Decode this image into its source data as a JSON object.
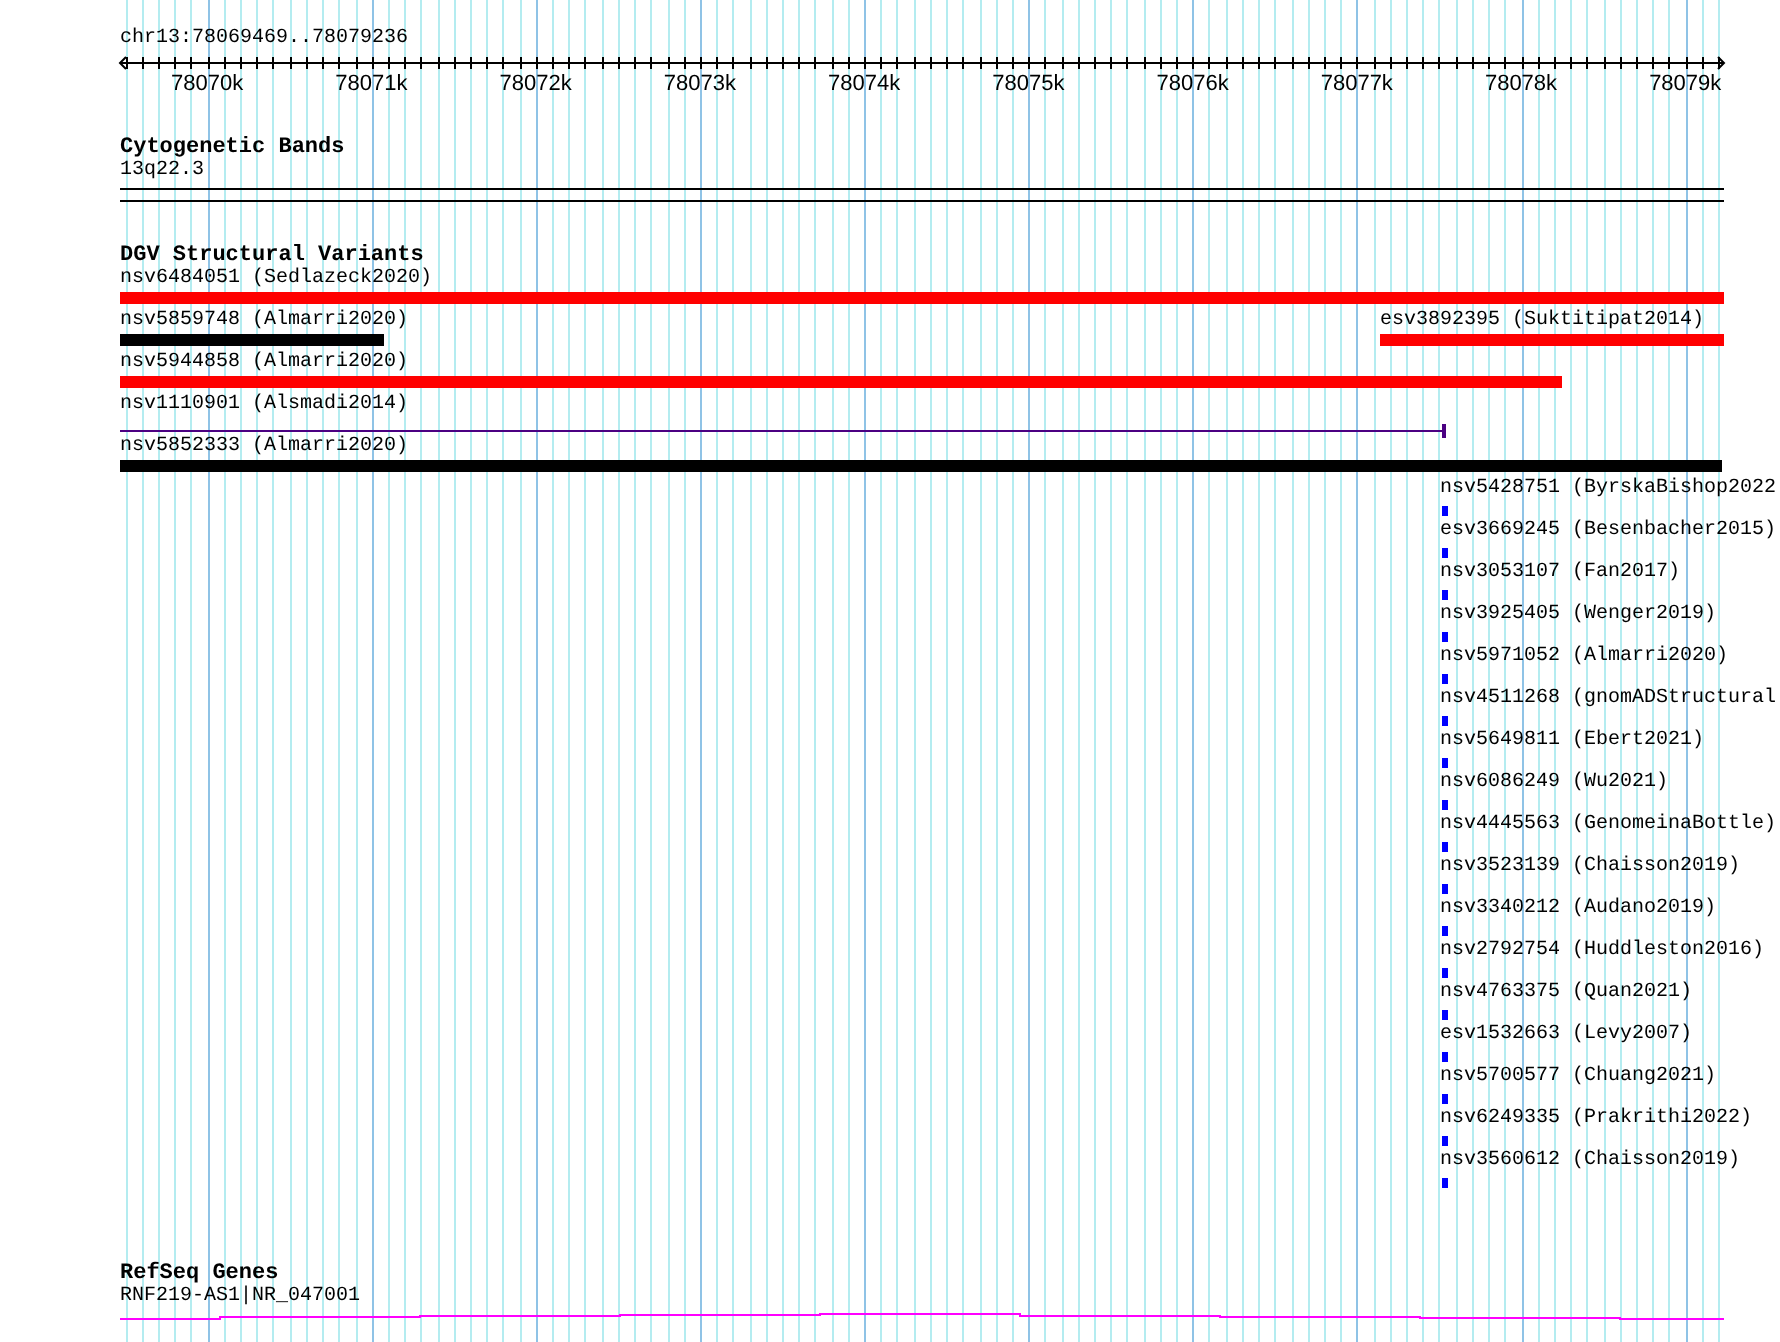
{
  "location": "chr13:78069469..78079236",
  "ruler": {
    "labels": [
      "78070k",
      "78071k",
      "78072k",
      "78073k",
      "78074k",
      "78075k",
      "78076k",
      "78077k",
      "78078k",
      "78079k"
    ]
  },
  "cytogenetic_bands": {
    "title": "Cytogenetic Bands",
    "band": {
      "label": "13q22.3"
    }
  },
  "dgv_structural_variants": {
    "title": "DGV Structural Variants",
    "features": [
      {
        "label": "nsv6484051 (Sedlazeck2020)",
        "kind": "bar",
        "color": "#ff0000"
      },
      {
        "label": "nsv5859748 (Almarri2020)",
        "kind": "bar",
        "color": "#000000"
      },
      {
        "label": "esv3892395 (Suktitipat2014)",
        "kind": "bar",
        "color": "#ff0000"
      },
      {
        "label": "nsv5944858 (Almarri2020)",
        "kind": "bar",
        "color": "#ff0000"
      },
      {
        "label": "nsv1110901 (Alsmadi2014)",
        "kind": "line",
        "color": "#4b0082"
      },
      {
        "label": "nsv5852333 (Almarri2020)",
        "kind": "bar",
        "color": "#000000"
      },
      {
        "label": "nsv5428751 (ByrskaBishop2022",
        "kind": "point",
        "color": "#0000ff"
      },
      {
        "label": "esv3669245 (Besenbacher2015)",
        "kind": "point",
        "color": "#0000ff"
      },
      {
        "label": "nsv3053107 (Fan2017)",
        "kind": "point",
        "color": "#0000ff"
      },
      {
        "label": "nsv3925405 (Wenger2019)",
        "kind": "point",
        "color": "#0000ff"
      },
      {
        "label": "nsv5971052 (Almarri2020)",
        "kind": "point",
        "color": "#0000ff"
      },
      {
        "label": "nsv4511268 (gnomADStructural",
        "kind": "point",
        "color": "#0000ff"
      },
      {
        "label": "nsv5649811 (Ebert2021)",
        "kind": "point",
        "color": "#0000ff"
      },
      {
        "label": "nsv6086249 (Wu2021)",
        "kind": "point",
        "color": "#0000ff"
      },
      {
        "label": "nsv4445563 (GenomeinaBottle)",
        "kind": "point",
        "color": "#0000ff"
      },
      {
        "label": "nsv3523139 (Chaisson2019)",
        "kind": "point",
        "color": "#0000ff"
      },
      {
        "label": "nsv3340212 (Audano2019)",
        "kind": "point",
        "color": "#0000ff"
      },
      {
        "label": "nsv2792754 (Huddleston2016)",
        "kind": "point",
        "color": "#0000ff"
      },
      {
        "label": "nsv4763375 (Quan2021)",
        "kind": "point",
        "color": "#0000ff"
      },
      {
        "label": "esv1532663 (Levy2007)",
        "kind": "point",
        "color": "#0000ff"
      },
      {
        "label": "nsv5700577 (Chuang2021)",
        "kind": "point",
        "color": "#0000ff"
      },
      {
        "label": "nsv6249335 (Prakrithi2022)",
        "kind": "point",
        "color": "#0000ff"
      },
      {
        "label": "nsv3560612 (Chaisson2019)",
        "kind": "point",
        "color": "#0000ff"
      }
    ]
  },
  "refseq_genes": {
    "title": "RefSeq Genes",
    "gene": {
      "label": "RNF219-AS1|NR_047001"
    }
  }
}
